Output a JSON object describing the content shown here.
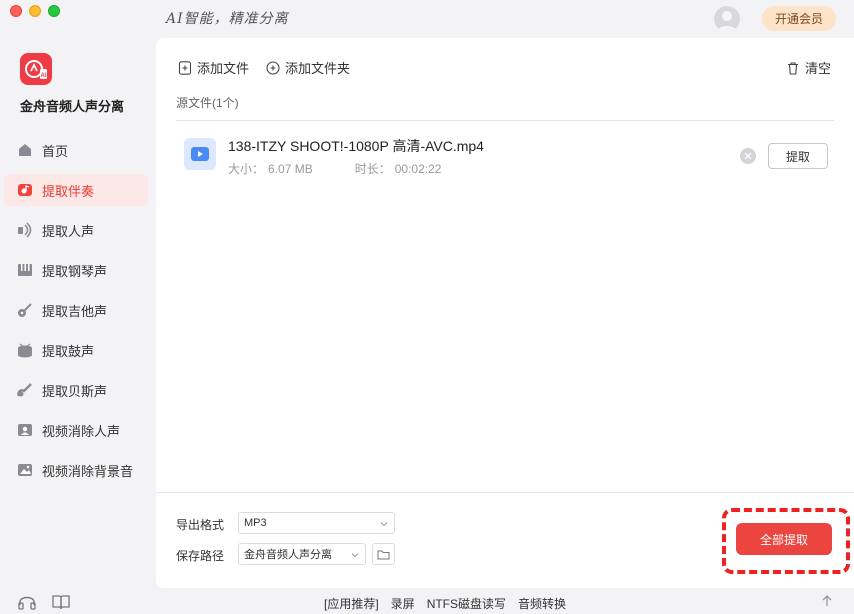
{
  "window": {
    "slogan": "AI智能，精准分离"
  },
  "header": {
    "vip_label": "开通会员"
  },
  "app": {
    "name": "金舟音频人声分离",
    "accent": "#ec4540"
  },
  "sidebar": {
    "items": [
      {
        "label": "首页",
        "icon": "home-icon",
        "active": false
      },
      {
        "label": "提取伴奏",
        "icon": "accompaniment-icon",
        "active": true
      },
      {
        "label": "提取人声",
        "icon": "voice-icon",
        "active": false
      },
      {
        "label": "提取钢琴声",
        "icon": "piano-icon",
        "active": false
      },
      {
        "label": "提取吉他声",
        "icon": "guitar-icon",
        "active": false
      },
      {
        "label": "提取鼓声",
        "icon": "drum-icon",
        "active": false
      },
      {
        "label": "提取贝斯声",
        "icon": "bass-icon",
        "active": false
      },
      {
        "label": "视频消除人声",
        "icon": "video-voice-icon",
        "active": false
      },
      {
        "label": "视频消除背景音",
        "icon": "video-bg-icon",
        "active": false
      }
    ]
  },
  "toolbar": {
    "add_file": "添加文件",
    "add_folder": "添加文件夹",
    "clear": "清空"
  },
  "source": {
    "label": "源文件(1个)"
  },
  "files": [
    {
      "name": "138-ITZY SHOOT!-1080P 高清-AVC.mp4",
      "size_label": "大小：",
      "size": "6.07 MB",
      "duration_label": "时长：",
      "duration": "00:02:22",
      "action": "提取"
    }
  ],
  "settings": {
    "format_label": "导出格式",
    "format_value": "MP3",
    "path_label": "保存路径",
    "path_value": "金舟音频人声分离"
  },
  "actions": {
    "extract_all": "全部提取"
  },
  "footer": {
    "links": [
      "[应用推荐]",
      "录屏",
      "NTFS磁盘读写",
      "音频转换"
    ]
  }
}
